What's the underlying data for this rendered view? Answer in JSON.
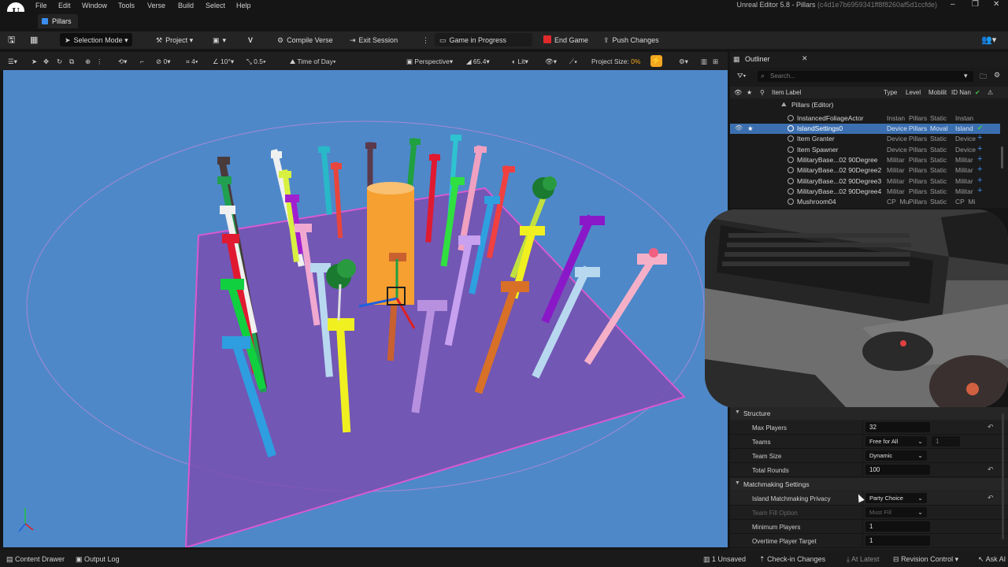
{
  "menu": {
    "items": [
      "File",
      "Edit",
      "Window",
      "Tools",
      "Verse",
      "Build",
      "Select",
      "Help"
    ]
  },
  "window": {
    "title": "Unreal Editor 5.8 - Pillars",
    "hash": "(c4d1e7b6959341ff8f8260af5d1ccfde)"
  },
  "tab": {
    "label": "Pillars"
  },
  "toolbar": {
    "selection_mode": "Selection Mode",
    "project": "Project",
    "compile_verse": "Compile Verse",
    "exit_session": "Exit Session",
    "game_status": "Game in Progress",
    "end_game": "End Game",
    "push_changes": "Push Changes"
  },
  "viewport_toolbar": {
    "rotate_snap_count": "0",
    "grid_snap": "4",
    "angle_snap": "10°",
    "scale_snap": "0.5",
    "time_of_day": "Time of Day",
    "perspective": "Perspective",
    "fov": "65.4",
    "view_mode": "Lit",
    "project_size_label": "Project Size:",
    "project_size_value": "0%"
  },
  "outliner": {
    "title": "Outliner",
    "search_placeholder": "Search...",
    "columns": {
      "label": "Item Label",
      "type": "Type",
      "level": "Level",
      "mobility": "Mobilit",
      "id": "ID Nan"
    },
    "root": "Pillars (Editor)",
    "rows": [
      {
        "label": "InstancedFoliageActor",
        "type": "Instan",
        "level": "Pillars",
        "mobility": "Static",
        "id": "Instan"
      },
      {
        "label": "IslandSettings0",
        "type": "Device",
        "level": "Pillars",
        "mobility": "Moval",
        "id": "Island"
      },
      {
        "label": "Item Granter",
        "type": "Device",
        "level": "Pillars",
        "mobility": "Static",
        "id": "Device"
      },
      {
        "label": "Item Spawner",
        "type": "Device",
        "level": "Pillars",
        "mobility": "Static",
        "id": "Device"
      },
      {
        "label": "MilitaryBase...02 90Degree",
        "type": "Militar",
        "level": "Pillars",
        "mobility": "Static",
        "id": "Militar"
      },
      {
        "label": "MilitaryBase...02 90Degree2",
        "type": "Militar",
        "level": "Pillars",
        "mobility": "Static",
        "id": "Militar"
      },
      {
        "label": "MilitaryBase...02 90Degree3",
        "type": "Militar",
        "level": "Pillars",
        "mobility": "Static",
        "id": "Militar"
      },
      {
        "label": "MilitaryBase...02 90Degree4",
        "type": "Militar",
        "level": "Pillars",
        "mobility": "Static",
        "id": "Militar"
      },
      {
        "label": "Mushroom04",
        "type": "CP_Mu",
        "level": "Pillars",
        "mobility": "Static",
        "id": "CP_Mi"
      }
    ]
  },
  "details": {
    "structure": {
      "title": "Structure",
      "max_players_label": "Max Players",
      "max_players": "32",
      "teams_label": "Teams",
      "teams": "Free for All",
      "teams_count": "1",
      "team_size_label": "Team Size",
      "team_size": "Dynamic",
      "total_rounds_label": "Total Rounds",
      "total_rounds": "100"
    },
    "matchmaking": {
      "title": "Matchmaking Settings",
      "privacy_label": "Island Matchmaking Privacy",
      "privacy": "Party Choice",
      "fill_label": "Team Fill Option",
      "fill": "Must Fill",
      "min_players_label": "Minimum Players",
      "min_players": "1",
      "overtime_label": "Overtime Player Target",
      "overtime": "1"
    }
  },
  "statusbar": {
    "content_drawer": "Content Drawer",
    "output_log": "Output Log",
    "unsaved": "1 Unsaved",
    "check_in": "Check-in Changes",
    "at_latest": "At Latest",
    "revision_control": "Revision Control",
    "ask_ai": "Ask AI"
  },
  "colors": {
    "accent": "#3b8df0",
    "viewport_bg": "#4e88c9",
    "end_game": "#e02a2a",
    "selected_row": "#3b6fb0"
  }
}
